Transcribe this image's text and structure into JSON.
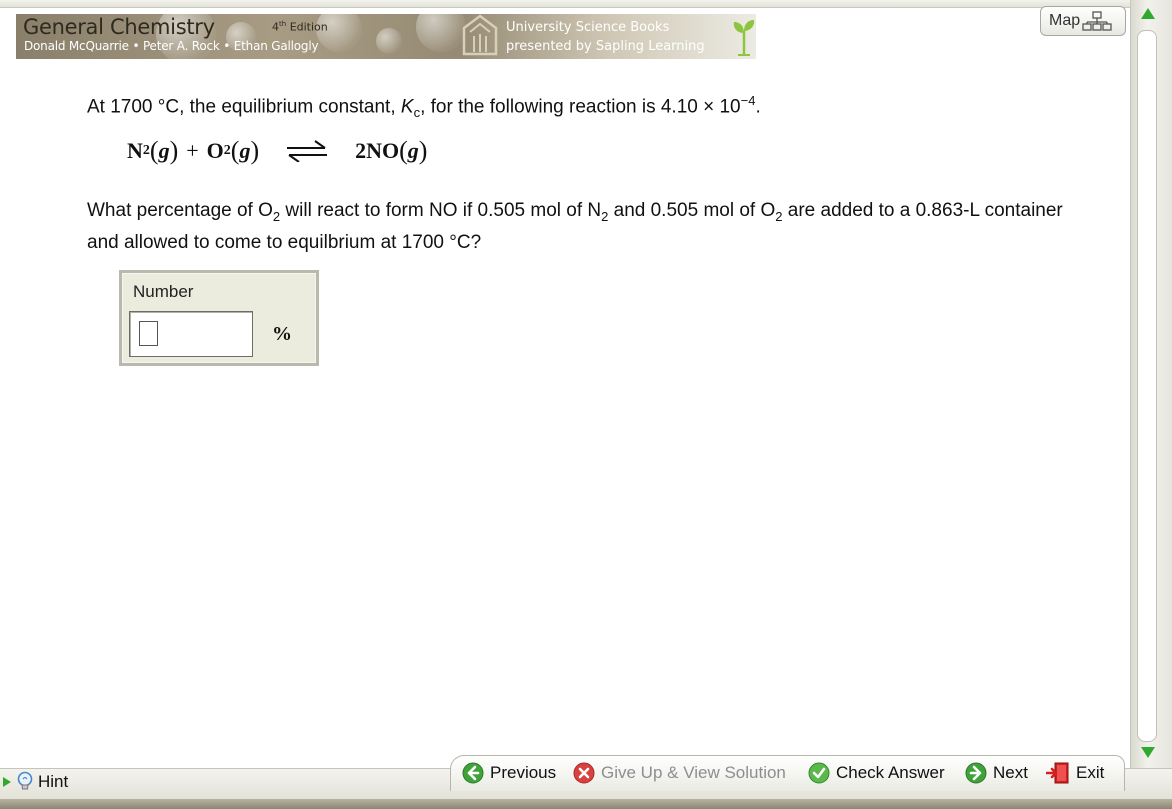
{
  "banner": {
    "title": "General Chemistry",
    "edition": "4th Edition",
    "edition_num": "4",
    "edition_suffix": "th",
    "edition_word": "Edition",
    "authors": "Donald McQuarrie • Peter A. Rock • Ethan Gallogly",
    "publisher_line1": "University Science Books",
    "publisher_line2": "presented by Sapling Learning"
  },
  "map_button": {
    "label": "Map",
    "icon": "sitemap-icon"
  },
  "problem": {
    "intro_prefix": "At 1700 °C, the equilibrium constant, ",
    "k_symbol": "K",
    "k_subscript": "c",
    "intro_middle": ", for the following reaction is 4.10 × 10",
    "exponent": "−4",
    "intro_suffix": ".",
    "equation": {
      "reactant1": "N",
      "reactant1_sub": "2",
      "phase": "g",
      "plus": "+",
      "reactant2": "O",
      "reactant2_sub": "2",
      "product": "2NO",
      "arrow_icon": "equilibrium-arrows-icon"
    },
    "question_1": "What percentage of O",
    "q_sub1": "2",
    "question_2": " will react to form NO if 0.505 mol of N",
    "q_sub2": "2",
    "question_3": " and 0.505 mol of O",
    "q_sub3": "2",
    "question_4": " are added to a 0.863-L container and allowed to come to equilbrium at 1700 °C?"
  },
  "answer": {
    "label": "Number",
    "value": "",
    "unit": "%"
  },
  "nav": {
    "hint": "Hint",
    "previous": "Previous",
    "give_up": "Give Up & View Solution",
    "check": "Check Answer",
    "next": "Next",
    "exit": "Exit"
  },
  "colors": {
    "green_nav": "#3fa33a",
    "red_giveup": "#d94141",
    "exit_red": "#d21f1f",
    "scroll_arrow": "#2faa2f"
  }
}
